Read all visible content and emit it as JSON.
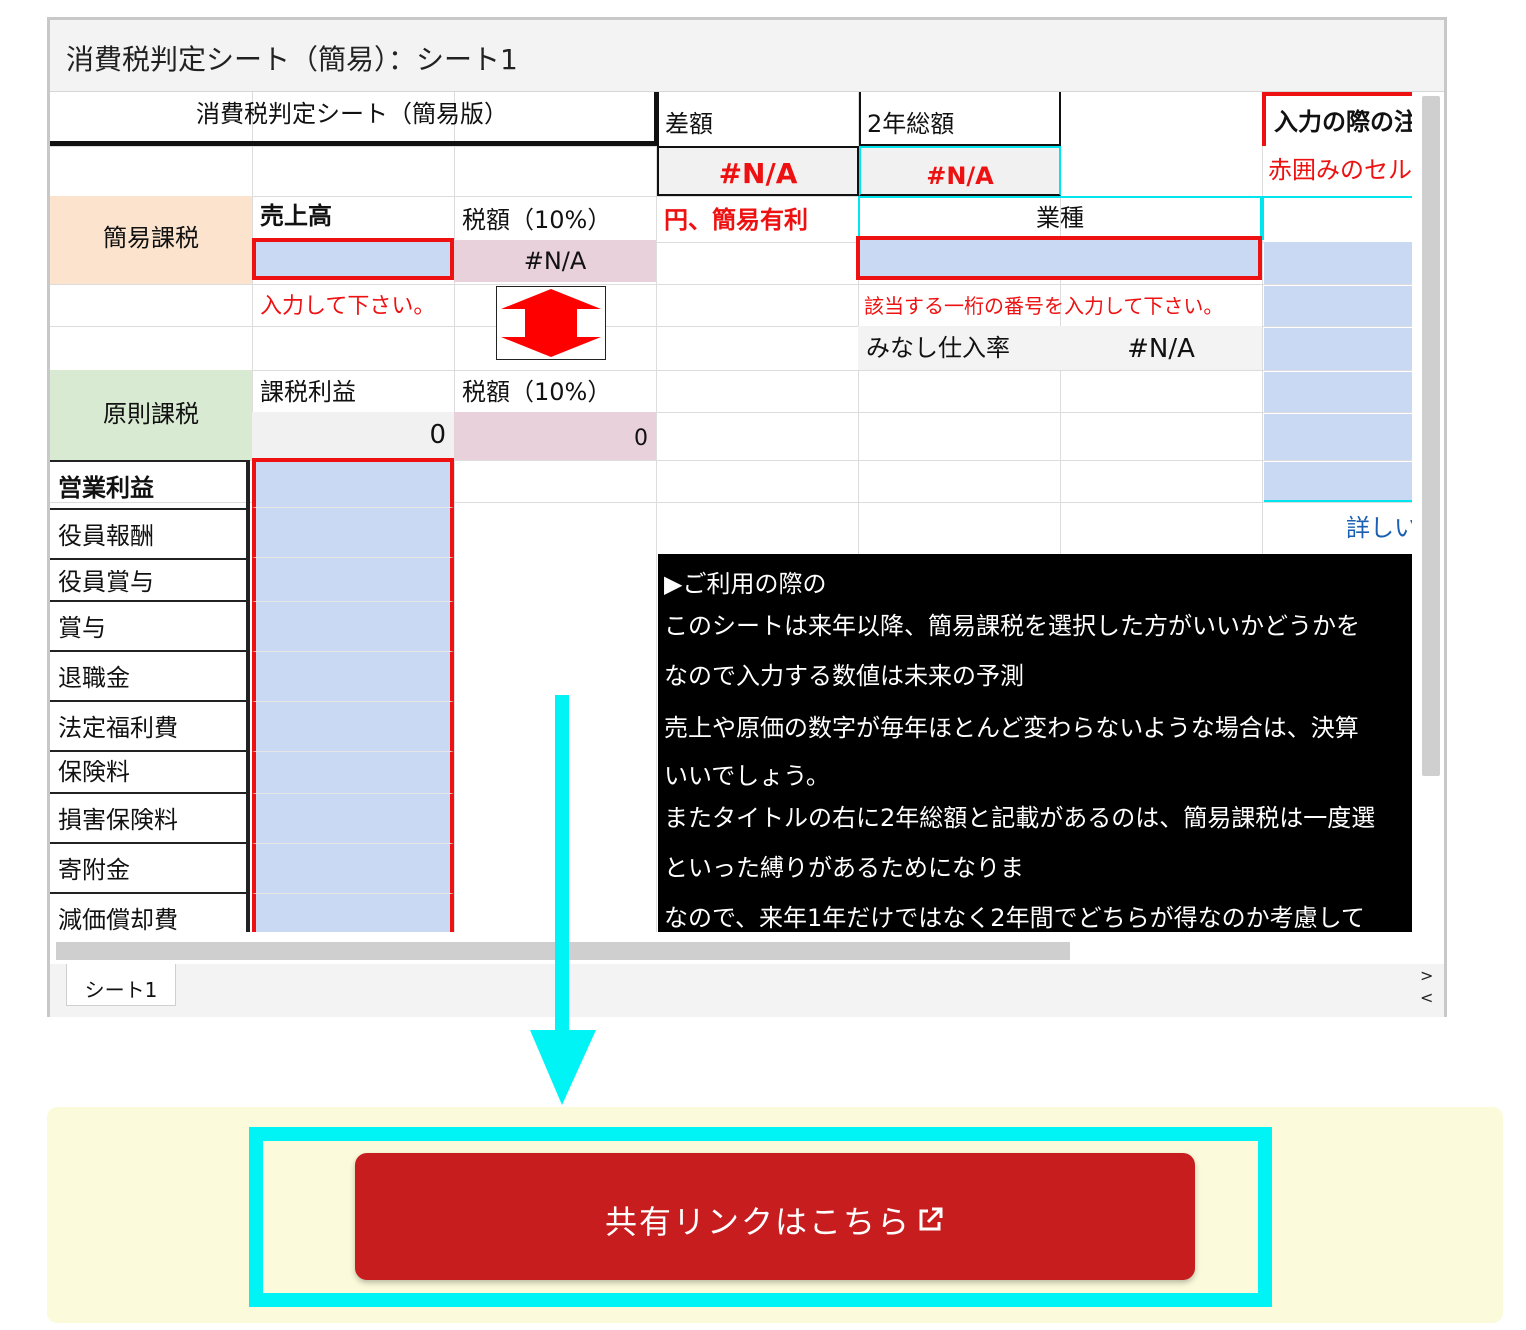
{
  "window": {
    "title": "消費税判定シート（簡易）：シート1"
  },
  "sheet": {
    "header_title": "消費税判定シート（簡易版）",
    "diff_label": "差額",
    "diff_value": "#N/A",
    "two_year_label": "2年総額",
    "two_year_value": "#N/A",
    "input_notice_header": "入力の際の注",
    "input_notice_sub": "赤囲みのセル",
    "simple_tax_label": "簡易課税",
    "sales_label": "売上高",
    "tax_10_label": "税額（10%）",
    "simple_tax_value": "#N/A",
    "simple_advantage": "円、簡易有利",
    "industry_label": "業種",
    "sales_prompt": "入力して下さい。",
    "industry_prompt": "該当する一桁の番号を入力して下さい。",
    "deemed_rate_label": "みなし仕入率",
    "deemed_rate_value": "#N/A",
    "principle_tax_label": "原則課税",
    "taxable_profit_label": "課税利益",
    "taxable_profit_value": "0",
    "principle_tax_10_label": "税額（10%）",
    "principle_tax_value": "0",
    "details_link": "詳しい",
    "expense_items": [
      "営業利益",
      "役員報酬",
      "役員賞与",
      "賞与",
      "退職金",
      "法定福利費",
      "保険料",
      "損害保険料",
      "寄附金",
      "減価償却費"
    ]
  },
  "note": {
    "lines": [
      "▶ご利用の際の",
      "このシートは来年以降、簡易課税を選択した方がいいかどうかを",
      "なので入力する数値は未来の予測",
      "売上や原価の数字が毎年ほとんど変わらないような場合は、決算",
      "いいでしょう。",
      "またタイトルの右に2年総額と記載があるのは、簡易課税は一度選",
      "といった縛りがあるためになりま",
      "なので、来年1年だけではなく2年間でどちらが得なのか考慮して"
    ]
  },
  "sheet_tabs": {
    "active": "シート1",
    "next": ">",
    "prev": "<"
  },
  "share": {
    "button_label": "共有リンクはこちら",
    "icon": "external-link-icon"
  },
  "colors": {
    "accent_red": "#c71d1f",
    "highlight_cyan": "#00f3f5",
    "input_blue": "#c9d9f3",
    "panel_yellow": "#fbfbdb"
  }
}
